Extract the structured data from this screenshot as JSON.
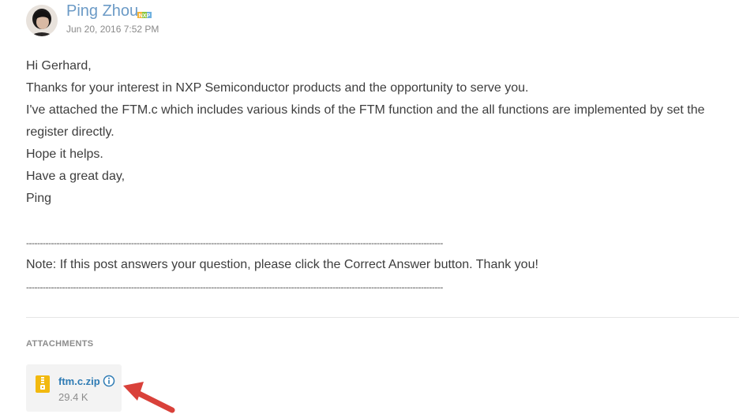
{
  "post": {
    "author": "Ping Zhou",
    "author_badge": "NXP",
    "date": "Jun 20, 2016 7:52 PM",
    "paragraphs": [
      "Hi Gerhard,",
      "Thanks for your interest in NXP Semiconductor products and the opportunity to serve you.",
      "I've attached the FTM.c which includes various kinds of the FTM function and the all functions are implemented by set the register directly.",
      "Hope it helps.",
      "Have a great day,",
      "Ping"
    ],
    "separator": "-------------------------------------------------------------------------------------------------------------------------------------------------------",
    "note": "Note: If this post answers your question, please click the Correct Answer button. Thank you!"
  },
  "attachments": {
    "heading": "ATTACHMENTS",
    "files": [
      {
        "name": "ftm.c.zip",
        "size": "29.4 K",
        "icon": "zip-file-icon"
      }
    ]
  },
  "colors": {
    "author": "#6b9ac6",
    "link": "#2e7bb4",
    "zip_icon": "#f2b90f",
    "arrow": "#d9413a"
  }
}
